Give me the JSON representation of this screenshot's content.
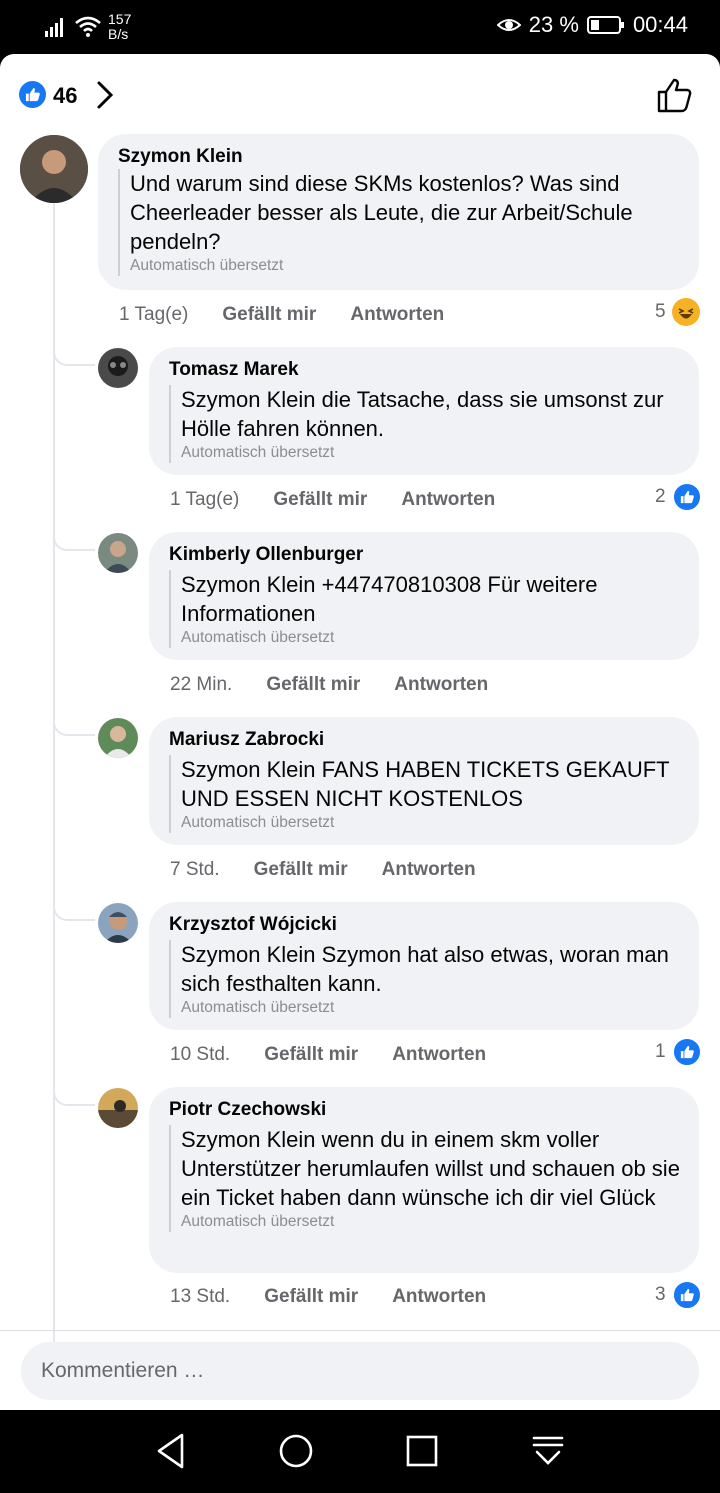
{
  "status": {
    "speed_value": "157",
    "speed_unit": "B/s",
    "battery": "23 %",
    "time": "00:44"
  },
  "header": {
    "like_count": "46"
  },
  "comments": [
    {
      "author": "Szymon Klein",
      "text": "Und warum sind diese SKMs kostenlos? Was sind Cheerleader besser als Leute, die zur Arbeit/Schule pendeln?",
      "translated_note": "Automatisch übersetzt",
      "time": "1 Tag(e)",
      "like_label": "Gefällt mir",
      "reply_label": "Antworten",
      "reaction_count": "5",
      "reaction_type": "haha"
    },
    {
      "author": "Tomasz Marek",
      "text": "Szymon Klein die Tatsache, dass sie umsonst zur Hölle fahren können.",
      "translated_note": "Automatisch übersetzt",
      "time": "1 Tag(e)",
      "like_label": "Gefällt mir",
      "reply_label": "Antworten",
      "reaction_count": "2",
      "reaction_type": "like"
    },
    {
      "author": "Kimberly Ollenburger",
      "text": "Szymon Klein +447470810308 Für weitere Informationen",
      "translated_note": "Automatisch übersetzt",
      "time": "22 Min.",
      "like_label": "Gefällt mir",
      "reply_label": "Antworten"
    },
    {
      "author": "Mariusz Zabrocki",
      "text": "Szymon Klein FANS HABEN TICKETS GEKAUFT UND ESSEN NICHT KOSTENLOS",
      "translated_note": "Automatisch übersetzt",
      "time": "7 Std.",
      "like_label": "Gefällt mir",
      "reply_label": "Antworten"
    },
    {
      "author": "Krzysztof Wójcicki",
      "text": "Szymon Klein Szymon hat also etwas, woran man sich festhalten kann.",
      "translated_note": "Automatisch übersetzt",
      "time": "10 Std.",
      "like_label": "Gefällt mir",
      "reply_label": "Antworten",
      "reaction_count": "1",
      "reaction_type": "like"
    },
    {
      "author": "Piotr Czechowski",
      "text": "Szymon Klein wenn du in einem skm voller Unterstützer herumlaufen willst und schauen ob sie ein Ticket haben dann wünsche ich dir viel Glück",
      "translated_note": "Automatisch übersetzt",
      "time": "13 Std.",
      "like_label": "Gefällt mir",
      "reply_label": "Antworten",
      "reaction_count": "3",
      "reaction_type": "like"
    }
  ],
  "composer": {
    "placeholder": "Kommentieren …"
  },
  "colors": {
    "accent": "#1877f2",
    "bubble": "#f0f2f5",
    "meta_text": "#65676b"
  }
}
